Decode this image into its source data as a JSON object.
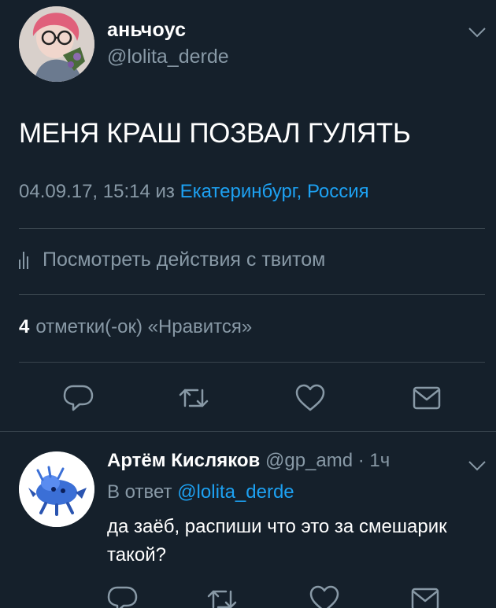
{
  "tweet": {
    "author_name": "аньчоус",
    "author_handle": "@lolita_derde",
    "text": "МЕНЯ КРАШ ПОЗВАЛ ГУЛЯТЬ",
    "datetime": "04.09.17, 15:14",
    "from_label": " из ",
    "location": "Екатеринбург, Россия",
    "activity_label": "Посмотреть действия с твитом",
    "likes_count": "4",
    "likes_label": "отметки(-ок) «Нравится»",
    "actions": [
      "reply-icon",
      "retweet-icon",
      "like-icon",
      "share-icon"
    ]
  },
  "reply": {
    "author_name": "Артём Кисляков",
    "author_handle": "@gp_amd",
    "separator": "·",
    "time": "1ч",
    "reply_prefix": "В ответ",
    "reply_mention": "@lolita_derde",
    "text": "да заёб, распиши что это за смешарик такой?",
    "actions": [
      "reply-icon",
      "retweet-icon",
      "like-icon",
      "share-icon"
    ]
  },
  "colors": {
    "background": "#15202b",
    "text": "#ffffff",
    "secondary": "#8899a6",
    "link": "#1da1f2",
    "divider": "#38444d"
  }
}
